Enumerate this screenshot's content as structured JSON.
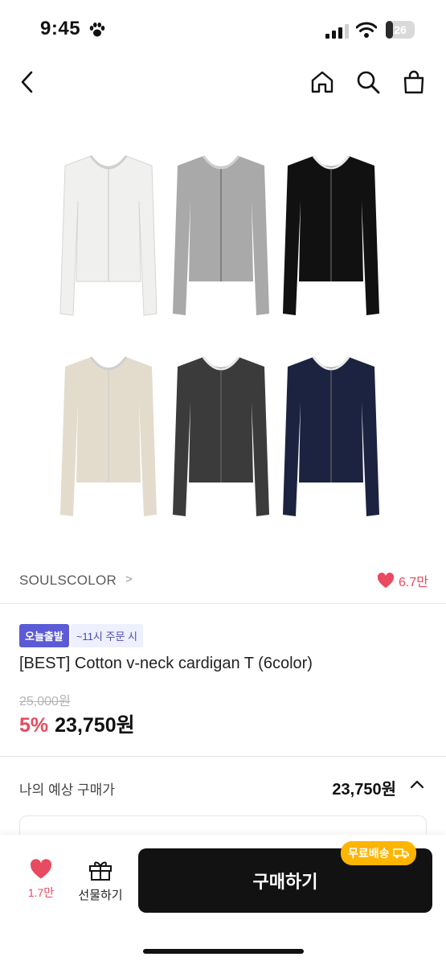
{
  "status_bar": {
    "time": "9:45",
    "battery": "26",
    "battery_level": 0.26
  },
  "nav": {
    "back_icon": "chevron-left-icon",
    "home_icon": "home-icon",
    "search_icon": "search-icon",
    "cart_icon": "shopping-bag-icon"
  },
  "product": {
    "image_colors": [
      "#f0f0ee",
      "#a9a9a9",
      "#111111",
      "#e3dccd",
      "#3b3b3b",
      "#1c2340"
    ],
    "brand": "SOULSCOLOR",
    "brand_chevron": ">",
    "like_count": "6.7만",
    "badge_today": "오늘출발",
    "badge_time": "~11시 주문 시",
    "title": "[BEST] Cotton v-neck cardigan T (6color)",
    "original_price": "25,000원",
    "discount": "5%",
    "final_price": "23,750원"
  },
  "expected_price": {
    "label": "나의 예상 구매가",
    "price": "23,750원"
  },
  "bottom_bar": {
    "like_count": "1.7만",
    "gift_label": "선물하기",
    "buy_label": "구매하기",
    "free_shipping": "무료배송"
  },
  "colors": {
    "accent_red": "#e84a5f",
    "badge_purple": "#5b5bd6",
    "free_ship_yellow": "#ffb400",
    "buy_button": "#121212"
  }
}
